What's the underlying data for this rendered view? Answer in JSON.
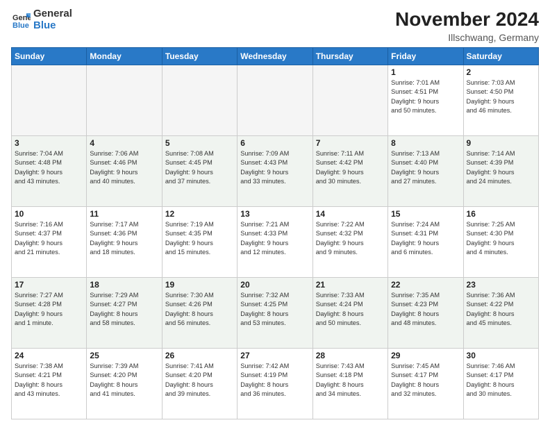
{
  "header": {
    "logo_general": "General",
    "logo_blue": "Blue",
    "month_title": "November 2024",
    "location": "Illschwang, Germany"
  },
  "weekdays": [
    "Sunday",
    "Monday",
    "Tuesday",
    "Wednesday",
    "Thursday",
    "Friday",
    "Saturday"
  ],
  "weeks": [
    [
      {
        "day": "",
        "info": ""
      },
      {
        "day": "",
        "info": ""
      },
      {
        "day": "",
        "info": ""
      },
      {
        "day": "",
        "info": ""
      },
      {
        "day": "",
        "info": ""
      },
      {
        "day": "1",
        "info": "Sunrise: 7:01 AM\nSunset: 4:51 PM\nDaylight: 9 hours\nand 50 minutes."
      },
      {
        "day": "2",
        "info": "Sunrise: 7:03 AM\nSunset: 4:50 PM\nDaylight: 9 hours\nand 46 minutes."
      }
    ],
    [
      {
        "day": "3",
        "info": "Sunrise: 7:04 AM\nSunset: 4:48 PM\nDaylight: 9 hours\nand 43 minutes."
      },
      {
        "day": "4",
        "info": "Sunrise: 7:06 AM\nSunset: 4:46 PM\nDaylight: 9 hours\nand 40 minutes."
      },
      {
        "day": "5",
        "info": "Sunrise: 7:08 AM\nSunset: 4:45 PM\nDaylight: 9 hours\nand 37 minutes."
      },
      {
        "day": "6",
        "info": "Sunrise: 7:09 AM\nSunset: 4:43 PM\nDaylight: 9 hours\nand 33 minutes."
      },
      {
        "day": "7",
        "info": "Sunrise: 7:11 AM\nSunset: 4:42 PM\nDaylight: 9 hours\nand 30 minutes."
      },
      {
        "day": "8",
        "info": "Sunrise: 7:13 AM\nSunset: 4:40 PM\nDaylight: 9 hours\nand 27 minutes."
      },
      {
        "day": "9",
        "info": "Sunrise: 7:14 AM\nSunset: 4:39 PM\nDaylight: 9 hours\nand 24 minutes."
      }
    ],
    [
      {
        "day": "10",
        "info": "Sunrise: 7:16 AM\nSunset: 4:37 PM\nDaylight: 9 hours\nand 21 minutes."
      },
      {
        "day": "11",
        "info": "Sunrise: 7:17 AM\nSunset: 4:36 PM\nDaylight: 9 hours\nand 18 minutes."
      },
      {
        "day": "12",
        "info": "Sunrise: 7:19 AM\nSunset: 4:35 PM\nDaylight: 9 hours\nand 15 minutes."
      },
      {
        "day": "13",
        "info": "Sunrise: 7:21 AM\nSunset: 4:33 PM\nDaylight: 9 hours\nand 12 minutes."
      },
      {
        "day": "14",
        "info": "Sunrise: 7:22 AM\nSunset: 4:32 PM\nDaylight: 9 hours\nand 9 minutes."
      },
      {
        "day": "15",
        "info": "Sunrise: 7:24 AM\nSunset: 4:31 PM\nDaylight: 9 hours\nand 6 minutes."
      },
      {
        "day": "16",
        "info": "Sunrise: 7:25 AM\nSunset: 4:30 PM\nDaylight: 9 hours\nand 4 minutes."
      }
    ],
    [
      {
        "day": "17",
        "info": "Sunrise: 7:27 AM\nSunset: 4:28 PM\nDaylight: 9 hours\nand 1 minute."
      },
      {
        "day": "18",
        "info": "Sunrise: 7:29 AM\nSunset: 4:27 PM\nDaylight: 8 hours\nand 58 minutes."
      },
      {
        "day": "19",
        "info": "Sunrise: 7:30 AM\nSunset: 4:26 PM\nDaylight: 8 hours\nand 56 minutes."
      },
      {
        "day": "20",
        "info": "Sunrise: 7:32 AM\nSunset: 4:25 PM\nDaylight: 8 hours\nand 53 minutes."
      },
      {
        "day": "21",
        "info": "Sunrise: 7:33 AM\nSunset: 4:24 PM\nDaylight: 8 hours\nand 50 minutes."
      },
      {
        "day": "22",
        "info": "Sunrise: 7:35 AM\nSunset: 4:23 PM\nDaylight: 8 hours\nand 48 minutes."
      },
      {
        "day": "23",
        "info": "Sunrise: 7:36 AM\nSunset: 4:22 PM\nDaylight: 8 hours\nand 45 minutes."
      }
    ],
    [
      {
        "day": "24",
        "info": "Sunrise: 7:38 AM\nSunset: 4:21 PM\nDaylight: 8 hours\nand 43 minutes."
      },
      {
        "day": "25",
        "info": "Sunrise: 7:39 AM\nSunset: 4:20 PM\nDaylight: 8 hours\nand 41 minutes."
      },
      {
        "day": "26",
        "info": "Sunrise: 7:41 AM\nSunset: 4:20 PM\nDaylight: 8 hours\nand 39 minutes."
      },
      {
        "day": "27",
        "info": "Sunrise: 7:42 AM\nSunset: 4:19 PM\nDaylight: 8 hours\nand 36 minutes."
      },
      {
        "day": "28",
        "info": "Sunrise: 7:43 AM\nSunset: 4:18 PM\nDaylight: 8 hours\nand 34 minutes."
      },
      {
        "day": "29",
        "info": "Sunrise: 7:45 AM\nSunset: 4:17 PM\nDaylight: 8 hours\nand 32 minutes."
      },
      {
        "day": "30",
        "info": "Sunrise: 7:46 AM\nSunset: 4:17 PM\nDaylight: 8 hours\nand 30 minutes."
      }
    ]
  ]
}
